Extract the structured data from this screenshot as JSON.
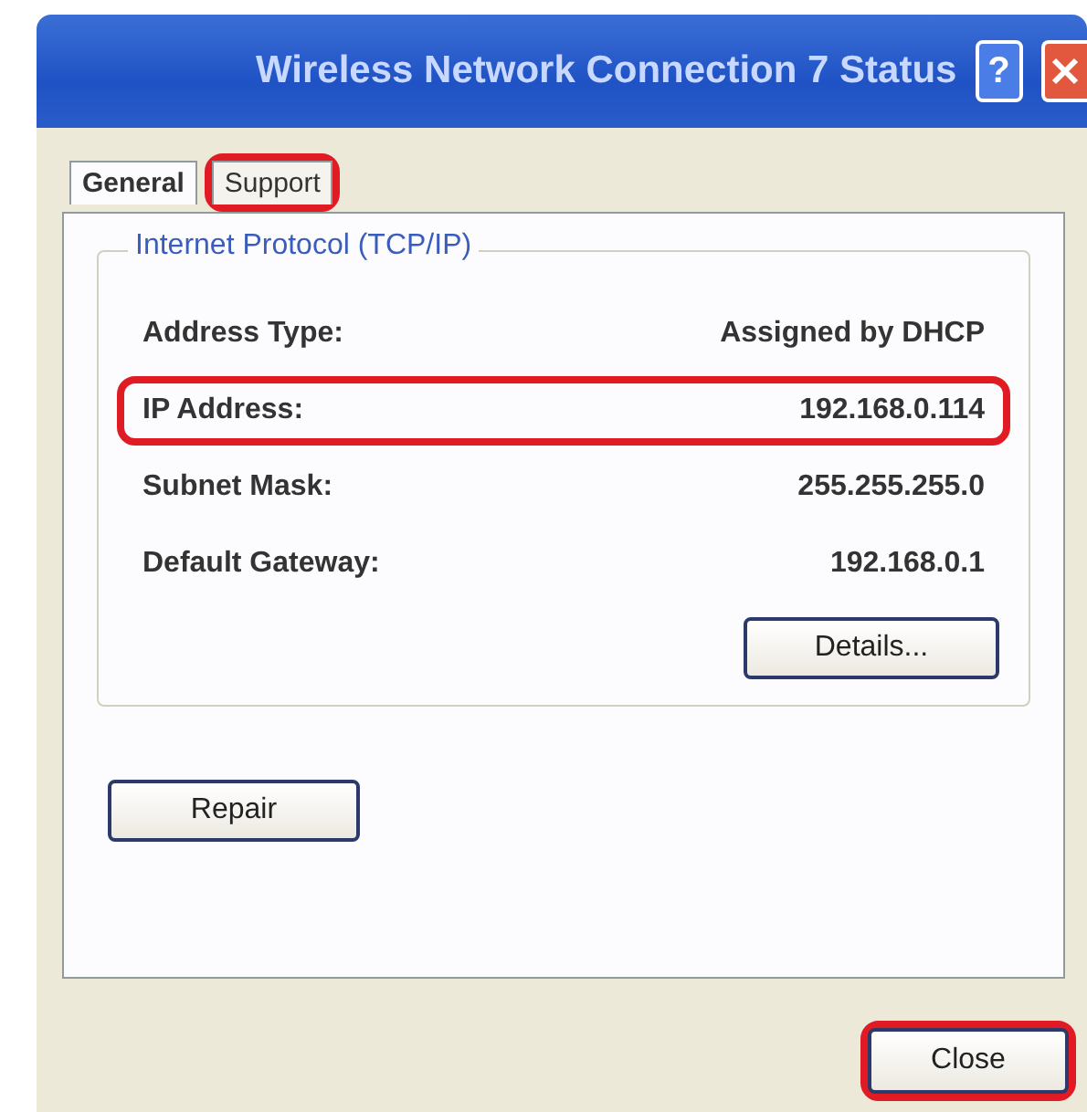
{
  "window": {
    "title": "Wireless Network Connection 7 Status",
    "help": "?"
  },
  "tabs": [
    {
      "label": "General",
      "selected": true,
      "highlighted": false
    },
    {
      "label": "Support",
      "selected": false,
      "highlighted": true
    }
  ],
  "group": {
    "title": "Internet Protocol (TCP/IP)",
    "rows": [
      {
        "label": "Address Type:",
        "value": "Assigned by DHCP",
        "highlighted": false
      },
      {
        "label": "IP Address:",
        "value": "192.168.0.114",
        "highlighted": true
      },
      {
        "label": "Subnet Mask:",
        "value": "255.255.255.0",
        "highlighted": false
      },
      {
        "label": "Default Gateway:",
        "value": "192.168.0.1",
        "highlighted": false
      }
    ],
    "details_button": "Details..."
  },
  "repair_button": "Repair",
  "close_button": {
    "label": "Close",
    "highlighted": true
  }
}
